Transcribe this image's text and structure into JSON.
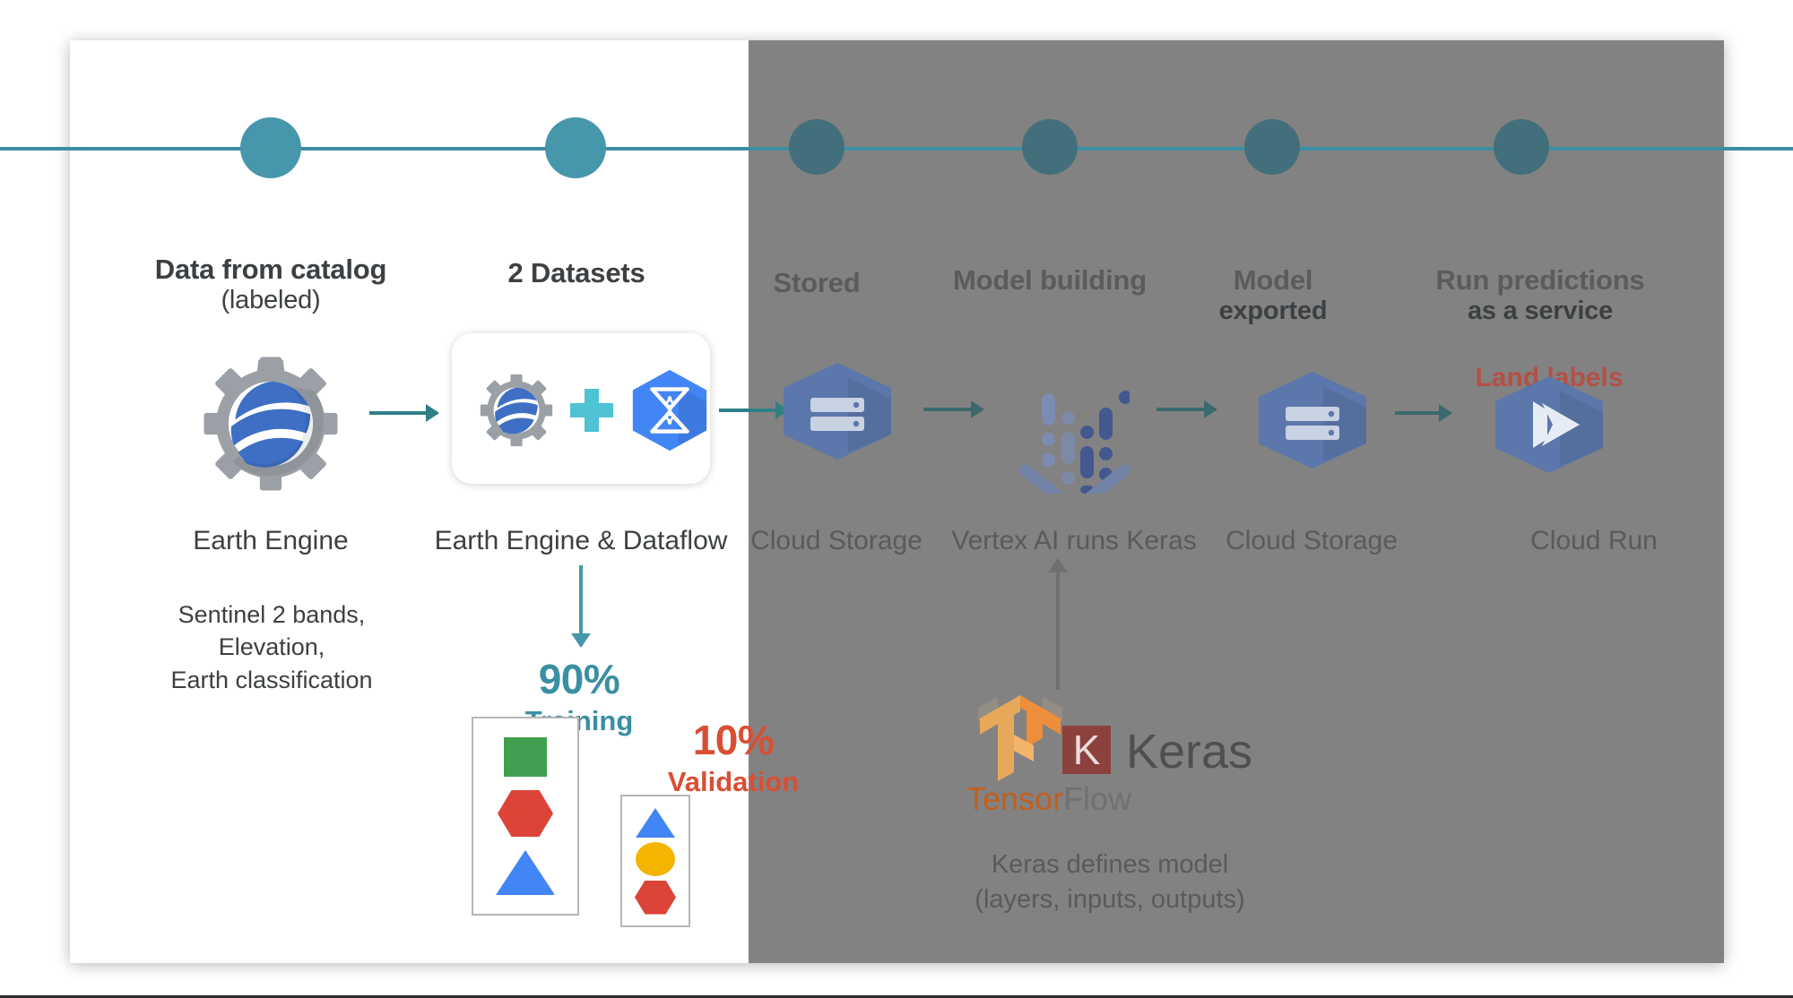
{
  "diagram": {
    "title_row": [
      {
        "label": "Data from catalog",
        "sub": "(labeled)"
      },
      {
        "label": "2 Datasets",
        "sub": ""
      },
      {
        "label": "Stored",
        "sub": ""
      },
      {
        "label": "Model building",
        "sub": ""
      },
      {
        "label": "Model",
        "sub": "exported"
      },
      {
        "label": "Run predictions",
        "sub": "as a service"
      }
    ],
    "services": {
      "earth_engine": "Earth Engine",
      "earth_engine_dataflow": "Earth Engine & Dataflow",
      "cloud_storage_1": "Cloud Storage",
      "vertex_ai": "Vertex AI runs Keras",
      "cloud_storage_2": "Cloud Storage",
      "cloud_run": "Cloud Run"
    },
    "notes": {
      "catalog_bands": "Sentinel 2 bands,\nElevation,\nEarth classification",
      "keras_model": "Keras defines model\n(layers, inputs, outputs)"
    },
    "output_badge": "Land labels",
    "split": {
      "training_pct": "90%",
      "training_label": "Training",
      "validation_pct": "10%",
      "validation_label": "Validation",
      "training_shapes": [
        "green-square",
        "red-hexagon",
        "blue-triangle"
      ],
      "validation_shapes": [
        "blue-triangle",
        "yellow-circle",
        "red-hexagon"
      ]
    },
    "frameworks": {
      "tensorflow_a": "Tensor",
      "tensorflow_b": "Flow",
      "keras_initial": "K",
      "keras_name": "Keras"
    },
    "colors": {
      "timeline": "#3a8fa3",
      "node_active": "#4697ac",
      "node_dim": "#436f7c",
      "training": "#3a8fa3",
      "validation": "#d94f33",
      "land_labels": "#b45046",
      "dim_overlay": "#828282",
      "arrow": "#2f7f85",
      "gcp_hex": "#5b77ab",
      "dataflow_hex": "#4285f4",
      "plus": "#4ec3d4",
      "green": "#41a050",
      "red": "#dc4437",
      "blue": "#4285f4",
      "yellow": "#f4b400",
      "keras_badge": "#8c413c"
    }
  }
}
